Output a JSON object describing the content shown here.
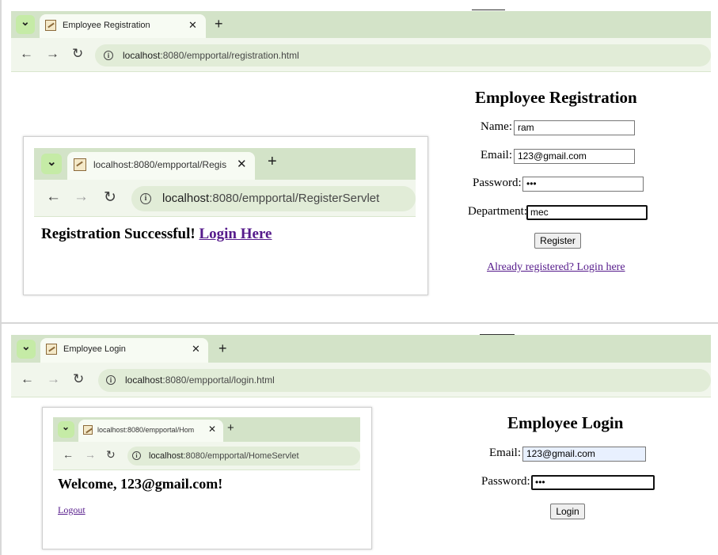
{
  "reg_browser": {
    "tab_title": "Employee Registration",
    "url_host": "localhost",
    "url_path": ":8080/empportal/registration.html"
  },
  "reg_form": {
    "heading": "Employee Registration",
    "name_label": "Name:",
    "name_value": "ram",
    "email_label": "Email:",
    "email_value": "123@gmail.com",
    "password_label": "Password:",
    "password_value": "•••",
    "department_label": "Department:",
    "department_value": "mec",
    "register_button": "Register",
    "login_link": "Already registered? Login here"
  },
  "reg_result_browser": {
    "tab_title": "localhost:8080/empportal/Regis",
    "url_host": "localhost",
    "url_path": ":8080/empportal/RegisterServlet",
    "message": "Registration Successful!",
    "login_link": "Login Here"
  },
  "login_browser": {
    "tab_title": "Employee Login",
    "url_host": "localhost",
    "url_path": ":8080/empportal/login.html"
  },
  "login_form": {
    "heading": "Employee Login",
    "email_label": "Email:",
    "email_value": "123@gmail.com",
    "password_label": "Password:",
    "password_value": "•••",
    "login_button": "Login"
  },
  "home_browser": {
    "tab_title": "localhost:8080/empportal/Hom",
    "url_host": "localhost",
    "url_path": ":8080/empportal/HomeServlet",
    "welcome": "Welcome, 123@gmail.com!",
    "logout_link": "Logout"
  },
  "icons": {
    "close": "✕",
    "new_tab": "+",
    "back": "←",
    "forward": "→",
    "reload": "↻",
    "tab_search": "⌄",
    "info": "i"
  }
}
